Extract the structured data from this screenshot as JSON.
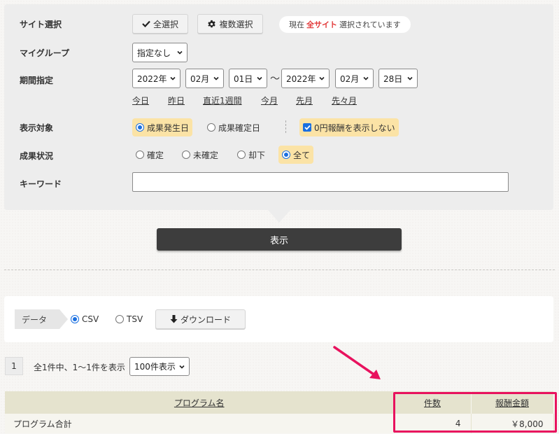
{
  "filter": {
    "site_select": {
      "label": "サイト選択",
      "select_all_label": "全選択",
      "multi_select_label": "複数選択",
      "status_prefix": "現在",
      "status_highlight": "全サイト",
      "status_suffix": "選択されています"
    },
    "my_group": {
      "label": "マイグループ",
      "value": "指定なし"
    },
    "period": {
      "label": "期間指定",
      "from_year": "2022年",
      "from_month": "02月",
      "from_day": "01日",
      "separator": "〜",
      "to_year": "2022年",
      "to_month": "02月",
      "to_day": "28日",
      "quick_links": [
        "今日",
        "昨日",
        "直近1週間",
        "今月",
        "先月",
        "先々月"
      ]
    },
    "display_target": {
      "label": "表示対象",
      "options": [
        "成果発生日",
        "成果確定日"
      ],
      "selected": "成果発生日",
      "hide_zero_label": "0円報酬を表示しない",
      "hide_zero_checked": true
    },
    "result_status": {
      "label": "成果状況",
      "options": [
        "確定",
        "未確定",
        "却下",
        "全て"
      ],
      "selected": "全て"
    },
    "keyword": {
      "label": "キーワード",
      "value": ""
    },
    "submit_label": "表示"
  },
  "export": {
    "tag_label": "データ",
    "formats": [
      "CSV",
      "TSV"
    ],
    "selected_format": "CSV",
    "download_label": "ダウンロード"
  },
  "pager": {
    "current_page": "1",
    "summary": "全1件中、1〜1件を表示",
    "per_page": "100件表示"
  },
  "table": {
    "headers": {
      "program": "プログラム名",
      "count": "件数",
      "reward": "報酬金額"
    },
    "rows": [
      {
        "program": "プログラム合計",
        "count": "4",
        "reward": "￥8,000"
      }
    ]
  },
  "colors": {
    "panel_bg": "#ededed",
    "accent_blue": "#1a6fe0",
    "option_highlight": "#fbe3a6",
    "status_red": "#e23a3a",
    "table_header": "#e5e3ce",
    "annotation_pink": "#e8125e",
    "submit_button": "#3d3d3d"
  },
  "icons": {
    "select_all": "checkmark-icon",
    "multi_select": "gear-icon",
    "download": "arrow-down-icon"
  }
}
